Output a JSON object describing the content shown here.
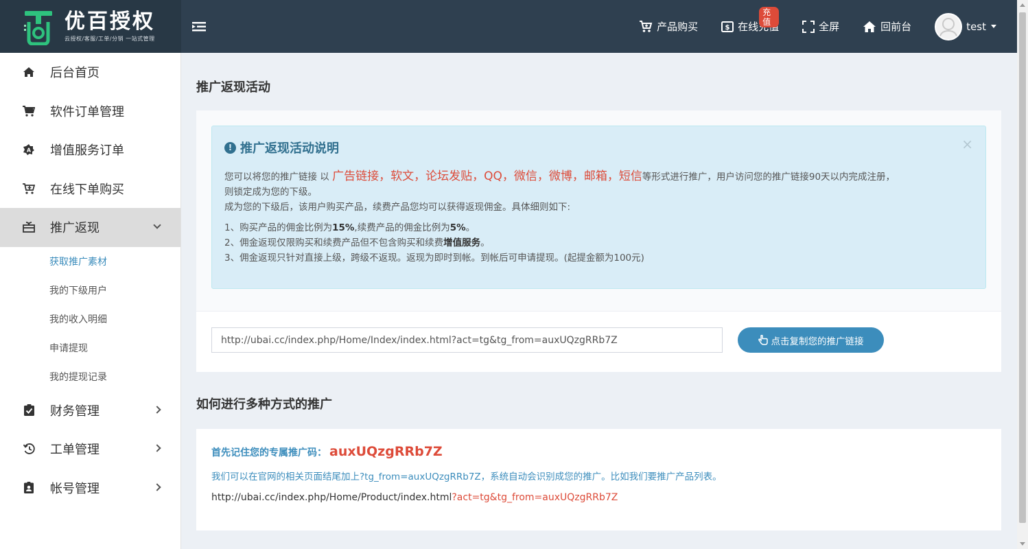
{
  "header": {
    "logo_title": "优百授权",
    "logo_sub": "云授权/客服/工单/分销 一站式管理",
    "nav": [
      {
        "label": "产品购买",
        "icon": "cart-plus-icon"
      },
      {
        "label": "在线充值",
        "icon": "money-icon",
        "badge": "充值"
      },
      {
        "label": "全屏",
        "icon": "fullscreen-icon"
      },
      {
        "label": "回前台",
        "icon": "home-icon"
      }
    ],
    "user": "test"
  },
  "sidebar": {
    "items": [
      {
        "label": "后台首页",
        "icon": "home-icon"
      },
      {
        "label": "软件订单管理",
        "icon": "cart-icon"
      },
      {
        "label": "增值服务订单",
        "icon": "service-icon"
      },
      {
        "label": "在线下单购买",
        "icon": "cart-plus-icon"
      },
      {
        "label": "推广返现",
        "icon": "gift-icon"
      },
      {
        "label": "财务管理",
        "icon": "clipboard-check-icon"
      },
      {
        "label": "工单管理",
        "icon": "history-icon"
      },
      {
        "label": "帐号管理",
        "icon": "id-badge-icon"
      }
    ],
    "submenu": [
      "获取推广素材",
      "我的下级用户",
      "我的收入明细",
      "申请提现",
      "我的提现记录"
    ]
  },
  "main": {
    "title": "推广返现活动",
    "callout": {
      "title": "推广返现活动说明",
      "p1_a": "您可以将您的推广链接 以 ",
      "p1_red": "广告链接，软文，论坛发贴，QQ，微信，微博，邮箱，短信",
      "p1_b": "等形式进行推广，用户访问您的推广链接90天以内完成注册，",
      "p1_c": "则锁定成为您的下级。",
      "p2": "成为您的下级后，该用户购买产品，续费产品您均可以获得返现佣金。具体细则如下:",
      "rule1_a": "1、购买产品的佣金比例为",
      "rule1_b": "15%",
      "rule1_c": ",续费产品的佣金比例为",
      "rule1_d": "5%",
      "rule1_e": "。",
      "rule2_a": "2、佣金返现仅限购买和续费产品但不包含购买和续费",
      "rule2_b": "增值服务",
      "rule2_c": "。",
      "rule3": "3、佣金返现只针对直接上级，跨级不返现。返现为即时到帐。到帐后可申请提现。(起提金额为100元)"
    },
    "link_value": "http://ubai.cc/index.php/Home/Index/index.html?act=tg&tg_from=auxUQzgRRb7Z",
    "copy_button": "点击复制您的推广链接",
    "section_title": "如何进行多种方式的推广",
    "code_label": "首先记住您的专属推广码：",
    "code": "auxUQzgRRb7Z",
    "hint": "我们可以在官网的相关页面结尾加上?tg_from=auxUQzgRRb7Z，系统自动会识别成您的推广。比如我们要推广产品列表。",
    "example_base": "http://ubai.cc/index.php/Home/Product/index.html",
    "example_tail": "?act=tg&tg_from=auxUQzgRRb7Z"
  }
}
